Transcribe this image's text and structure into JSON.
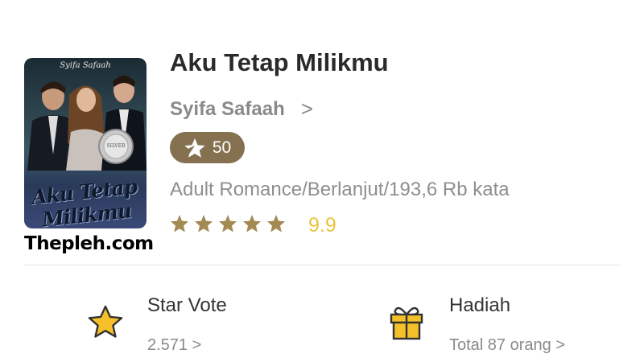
{
  "book": {
    "cover_author": "Syifa Safaah",
    "cover_title": "Aku Tetap Milikmu",
    "cover_badge": "SILVER",
    "title": "Aku Tetap Milikmu",
    "author": "Syifa Safaah",
    "author_chevron": ">",
    "rank_value": "50",
    "genre_line": "Adult Romance/Berlanjut/193,6 Rb kata",
    "star_count": 5,
    "rating": "9.9"
  },
  "watermark": "Thepleh.com",
  "stats": {
    "star_vote": {
      "label": "Star Vote",
      "value": "2.571 >"
    },
    "gift": {
      "label": "Hadiah",
      "value": "Total 87 orang >"
    }
  },
  "colors": {
    "rank_badge_bg": "#85714f",
    "star_fill": "#a38a52",
    "rating_text": "#e8c43e",
    "vote_star": "#f5c02a",
    "gift_fill": "#f5c02a"
  },
  "icons": {
    "rank": "rank-star-icon",
    "rating_stars": "star-icon",
    "vote": "star-vote-icon",
    "gift": "gift-icon"
  }
}
